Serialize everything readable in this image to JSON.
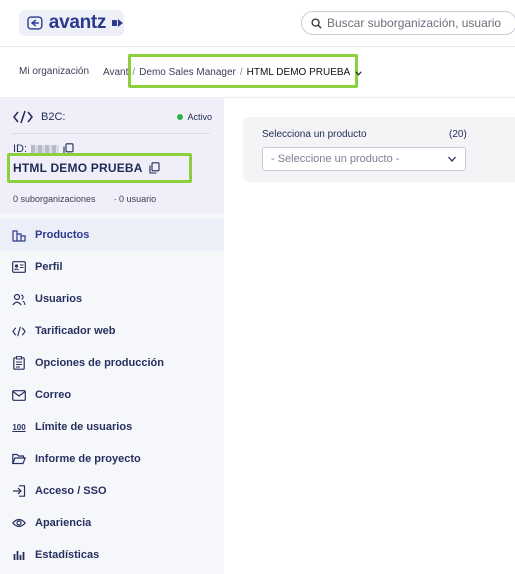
{
  "header": {
    "logo_text": "avantz",
    "search_placeholder": "Buscar suborganización, usuario"
  },
  "breadcrumb": {
    "root": "Mi organización",
    "items": [
      "Avant",
      "Demo Sales Manager",
      "HTML DEMO PRUEBA"
    ],
    "separator": "/"
  },
  "org": {
    "type_label": "B2C:",
    "status": "Activo",
    "id_label": "ID:",
    "name": "HTML DEMO PRUEBA",
    "suborgs": "0 suborganizaciones",
    "users": "· 0 usuario"
  },
  "sidebar": {
    "items": [
      {
        "label": "Productos",
        "icon": "products-icon",
        "active": true
      },
      {
        "label": "Perfil",
        "icon": "profile-card-icon"
      },
      {
        "label": "Usuarios",
        "icon": "users-icon"
      },
      {
        "label": "Tarificador web",
        "icon": "code-icon"
      },
      {
        "label": "Opciones de producción",
        "icon": "clipboard-icon"
      },
      {
        "label": "Correo",
        "icon": "mail-icon"
      },
      {
        "label": "Límite de usuarios",
        "icon": "limit-100-icon"
      },
      {
        "label": "Informe de proyecto",
        "icon": "folder-open-icon"
      },
      {
        "label": "Acceso / SSO",
        "icon": "login-icon"
      },
      {
        "label": "Apariencia",
        "icon": "eye-icon"
      },
      {
        "label": "Estadísticas",
        "icon": "bar-chart-icon"
      }
    ]
  },
  "product_select": {
    "label": "Selecciona un producto",
    "count": "(20)",
    "placeholder": "- Seleccione un producto -"
  },
  "colors": {
    "accent": "#2b3a8f",
    "highlight_green": "#8ccf3f",
    "status_green": "#2fb344"
  }
}
